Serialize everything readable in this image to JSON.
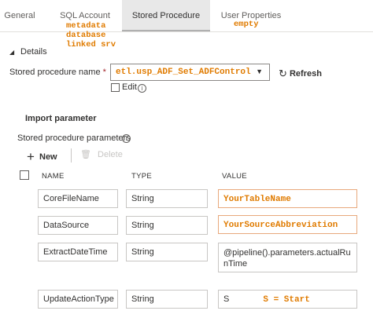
{
  "tabs": [
    {
      "label": "General"
    },
    {
      "label": "SQL Account"
    },
    {
      "label": "Stored Procedure"
    },
    {
      "label": "User Properties"
    }
  ],
  "annotations": {
    "sql_account": [
      "metadata",
      "database",
      "linked srv"
    ],
    "user_properties": "empty"
  },
  "details": {
    "section_label": "Details",
    "sp_name_label": "Stored procedure name",
    "required_mark": "*",
    "sp_name_value": "etl.usp_ADF_Set_ADFControl",
    "refresh_label": "Refresh",
    "edit_label": "Edit"
  },
  "import": {
    "heading": "Import parameter",
    "params_label": "Stored procedure parameters",
    "new_label": "New",
    "delete_label": "Delete"
  },
  "table": {
    "headers": {
      "name": "NAME",
      "type": "TYPE",
      "value": "VALUE"
    },
    "rows": [
      {
        "name": "CoreFileName",
        "type": "String",
        "value": "YourTableName"
      },
      {
        "name": "DataSource",
        "type": "String",
        "value": "YourSourceAbbreviation"
      },
      {
        "name": "ExtractDateTime",
        "type": "String",
        "value": "@pipeline().parameters.actualRunTime"
      },
      {
        "name": "UpdateActionType",
        "type": "String",
        "value": "S",
        "note": "S = Start"
      }
    ]
  }
}
